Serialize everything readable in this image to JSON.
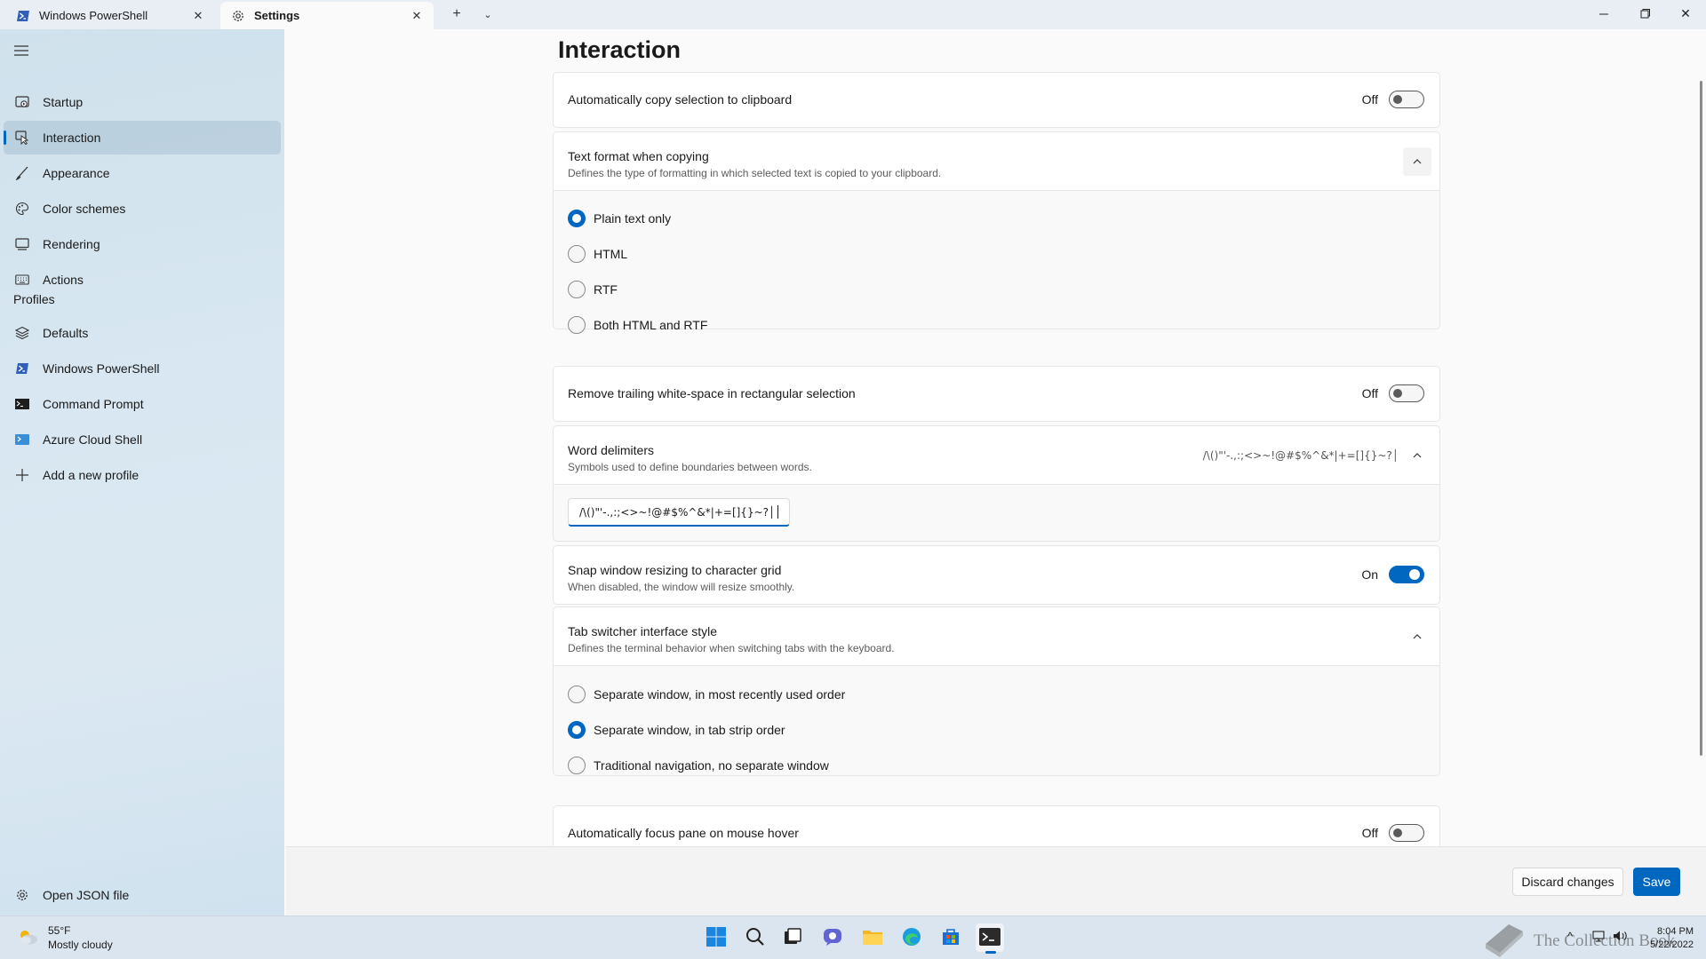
{
  "tabs": [
    {
      "label": "Windows PowerShell",
      "icon": "powershell-icon"
    },
    {
      "label": "Settings",
      "icon": "gear-icon"
    }
  ],
  "sidebar": {
    "items": [
      {
        "label": "Startup",
        "icon": "startup-icon"
      },
      {
        "label": "Interaction",
        "icon": "interaction-icon",
        "selected": true
      },
      {
        "label": "Appearance",
        "icon": "brush-icon"
      },
      {
        "label": "Color schemes",
        "icon": "palette-icon"
      },
      {
        "label": "Rendering",
        "icon": "monitor-icon"
      },
      {
        "label": "Actions",
        "icon": "keyboard-icon"
      }
    ],
    "profiles_header": "Profiles",
    "profiles": [
      {
        "label": "Defaults",
        "icon": "layers-icon"
      },
      {
        "label": "Windows PowerShell",
        "icon": "powershell-icon"
      },
      {
        "label": "Command Prompt",
        "icon": "cmd-icon"
      },
      {
        "label": "Azure Cloud Shell",
        "icon": "azure-icon"
      },
      {
        "label": "Add a new profile",
        "icon": "plus-icon"
      }
    ],
    "open_json": "Open JSON file"
  },
  "page": {
    "title": "Interaction",
    "copy_on_select": {
      "title": "Automatically copy selection to clipboard",
      "state": "Off"
    },
    "text_format": {
      "title": "Text format when copying",
      "subtitle": "Defines the type of formatting in which selected text is copied to your clipboard.",
      "options": [
        "Plain text only",
        "HTML",
        "RTF",
        "Both HTML and RTF"
      ],
      "selected": "Plain text only"
    },
    "trim_whitespace": {
      "title": "Remove trailing white-space in rectangular selection",
      "state": "Off"
    },
    "word_delimiters": {
      "title": "Word delimiters",
      "subtitle": "Symbols used to define boundaries between words.",
      "preview": "/\\()\"'-.,:;<>~!@#$%^&*|+=[]{}~?│",
      "value": "/\\()\"'-.,:;<>~!@#$%^&*|+=[]{}~?│"
    },
    "snap_resize": {
      "title": "Snap window resizing to character grid",
      "subtitle": "When disabled, the window will resize smoothly.",
      "state": "On"
    },
    "tab_switcher": {
      "title": "Tab switcher interface style",
      "subtitle": "Defines the terminal behavior when switching tabs with the keyboard.",
      "options": [
        "Separate window, in most recently used order",
        "Separate window, in tab strip order",
        "Traditional navigation, no separate window"
      ],
      "selected": "Separate window, in tab strip order"
    },
    "focus_follow_mouse": {
      "title": "Automatically focus pane on mouse hover",
      "state": "Off"
    }
  },
  "footer": {
    "discard": "Discard changes",
    "save": "Save"
  },
  "taskbar": {
    "weather_temp": "55°F",
    "weather_desc": "Mostly cloudy",
    "time": "8:04 PM",
    "date": "5/22/2022",
    "watermark": "The Collection Book"
  },
  "colors": {
    "accent": "#0067c0"
  }
}
